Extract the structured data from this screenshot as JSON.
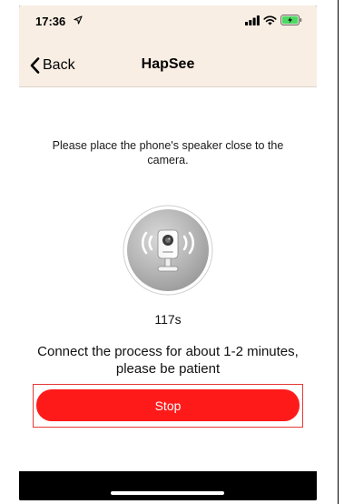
{
  "status_bar": {
    "time": "17:36",
    "location_icon": "location-arrow-icon",
    "signal_icon": "cellular-signal-icon",
    "wifi_icon": "wifi-icon",
    "battery_icon": "battery-charging-icon",
    "battery_color": "#4cd964"
  },
  "nav": {
    "back_label": "Back",
    "back_icon": "chevron-left-icon",
    "title": "HapSee"
  },
  "main": {
    "instruction": "Please place the phone's speaker close to the camera.",
    "camera_icon": "camera-sound-icon",
    "countdown": "117s",
    "process_text": "Connect the process for about 1-2 minutes, please be patient",
    "stop_label": "Stop"
  },
  "colors": {
    "header_background": "#f8eee3",
    "accent": "#ff1a1a",
    "highlight_border": "#e53935"
  }
}
